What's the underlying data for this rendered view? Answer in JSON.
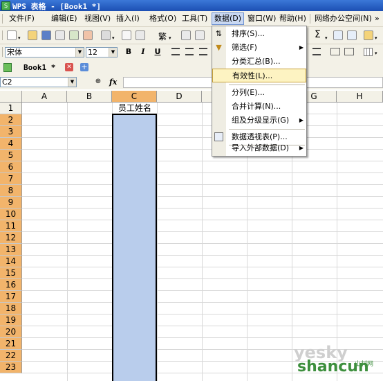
{
  "titlebar": {
    "title": "WPS 表格 - [Book1 *]",
    "app_icon": "S"
  },
  "menubar": {
    "items": [
      "文件(F)",
      "编辑(E)",
      "视图(V)",
      "插入(I)",
      "格式(O)",
      "工具(T)",
      "数据(D)",
      "窗口(W)",
      "帮助(H)",
      "网络办公空间(N)"
    ],
    "active": "数据(D)",
    "overflow": "»"
  },
  "toolbar2": {
    "font_name": "宋体",
    "font_size": "12",
    "bold": "B",
    "italic": "I",
    "underline": "U"
  },
  "toolbar1": {
    "sum": "Σ",
    "style_btn": "繁"
  },
  "tabbar": {
    "doc_tab": "Book1 *"
  },
  "formulabar": {
    "name_box": "C2",
    "fx": "fx",
    "content": ""
  },
  "grid": {
    "columns": [
      "A",
      "B",
      "C",
      "D",
      "E",
      "F",
      "G",
      "H"
    ],
    "selected_column": "C",
    "rows": [
      "1",
      "2",
      "3",
      "4",
      "5",
      "6",
      "7",
      "8",
      "9",
      "10",
      "11",
      "12",
      "13",
      "14",
      "15",
      "16",
      "17",
      "18",
      "19",
      "20",
      "21",
      "22",
      "23"
    ],
    "selected_rows_from": "2",
    "cell_C1": "员工姓名"
  },
  "dropdown": {
    "items": [
      {
        "label": "排序(S)...",
        "icon": "sort-icon",
        "submenu": false
      },
      {
        "label": "筛选(F)",
        "icon": "filter-icon",
        "submenu": true
      },
      {
        "label": "分类汇总(B)...",
        "icon": "",
        "submenu": false
      },
      {
        "label": "有效性(L)...",
        "icon": "",
        "submenu": false,
        "highlighted": true
      },
      {
        "label": "分列(E)...",
        "icon": "",
        "submenu": false
      },
      {
        "label": "合并计算(N)...",
        "icon": "",
        "submenu": false
      },
      {
        "label": "组及分级显示(G)",
        "icon": "",
        "submenu": true
      },
      {
        "label": "数据透视表(P)...",
        "icon": "pivot-icon",
        "submenu": false
      },
      {
        "label": "导入外部数据(D)",
        "icon": "",
        "submenu": true
      }
    ]
  },
  "watermark": {
    "top": "yesky",
    "bottom": "shancun",
    "small": "山村网"
  },
  "colors": {
    "selection": "#b9cdec",
    "header_selected": "#f2b46b",
    "menu_highlight": "#fdf3c2"
  }
}
